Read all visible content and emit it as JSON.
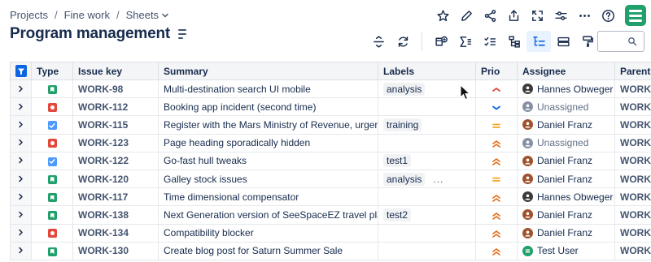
{
  "breadcrumb": {
    "items": [
      "Projects",
      "Fine work",
      "Sheets"
    ],
    "separator": "/"
  },
  "page": {
    "title": "Program management"
  },
  "top_actions": [
    "star-icon",
    "edit-icon",
    "share-icon",
    "export-icon",
    "fullscreen-icon",
    "settings-sliders-icon",
    "more-icon",
    "help-icon",
    "app-logo"
  ],
  "toolbar": {
    "tools": [
      "row-height-icon",
      "refresh-icon",
      "add-field-icon",
      "sum-icon",
      "checklist-icon",
      "hierarchy-icon",
      "hierarchy-structure-icon",
      "card-view-icon",
      "paint-format-icon"
    ],
    "active_tool": "hierarchy-structure-icon",
    "search_placeholder": ""
  },
  "table": {
    "columns": [
      "Type",
      "Issue key",
      "Summary",
      "Labels",
      "Prio",
      "Assignee",
      "Parent"
    ],
    "rows": [
      {
        "type": "story",
        "key": "WORK-98",
        "summary": "Multi-destination search UI mobile",
        "labels": [
          "analysis"
        ],
        "more": "",
        "priority": "high",
        "assignee": "Hannes Obweger",
        "avatar": "hannes",
        "parent": "WORK"
      },
      {
        "type": "bug",
        "key": "WORK-112",
        "summary": "Booking app incident (second time)",
        "labels": [],
        "more": "",
        "priority": "low",
        "assignee": "Unassigned",
        "avatar": "none",
        "parent": "WORK"
      },
      {
        "type": "task",
        "key": "WORK-115",
        "summary": "Register with the Mars Ministry of Revenue, urgently",
        "labels": [
          "training"
        ],
        "more": "",
        "priority": "medium",
        "assignee": "Daniel Franz",
        "avatar": "daniel",
        "parent": "WORK"
      },
      {
        "type": "bug",
        "key": "WORK-123",
        "summary": "Page heading sporadically hidden",
        "labels": [],
        "more": "",
        "priority": "highest",
        "assignee": "Unassigned",
        "avatar": "none",
        "parent": "WORK"
      },
      {
        "type": "task",
        "key": "WORK-122",
        "summary": "Go-fast hull tweaks",
        "labels": [
          "test1"
        ],
        "more": "",
        "priority": "highest",
        "assignee": "Daniel Franz",
        "avatar": "daniel",
        "parent": "WORK"
      },
      {
        "type": "story",
        "key": "WORK-120",
        "summary": "Galley stock issues",
        "labels": [
          "analysis"
        ],
        "more": "...",
        "priority": "medium",
        "assignee": "Daniel Franz",
        "avatar": "daniel",
        "parent": "WORK"
      },
      {
        "type": "story",
        "key": "WORK-117",
        "summary": "Time dimensional compensator",
        "labels": [],
        "more": "",
        "priority": "highest",
        "assignee": "Hannes Obweger",
        "avatar": "hannes",
        "parent": "WORK"
      },
      {
        "type": "story",
        "key": "WORK-138",
        "summary": "Next Generation version of SeeSpaceEZ travel platf…",
        "labels": [
          "test2"
        ],
        "more": "",
        "priority": "highest",
        "assignee": "Daniel Franz",
        "avatar": "daniel",
        "parent": "WORK"
      },
      {
        "type": "bug",
        "key": "WORK-134",
        "summary": "Compatibility blocker",
        "labels": [],
        "more": "",
        "priority": "highest",
        "assignee": "Daniel Franz",
        "avatar": "daniel",
        "parent": "WORK"
      },
      {
        "type": "story",
        "key": "WORK-130",
        "summary": "Create blog post for Saturn Summer Sale",
        "labels": [],
        "more": "",
        "priority": "highest",
        "assignee": "Test User",
        "avatar": "test",
        "parent": "WORK"
      }
    ]
  },
  "colors": {
    "accent": "#0c66e4",
    "story": "#22a06b",
    "bug": "#e2483d",
    "task": "#4c9aff",
    "priority_high": "#e2483d",
    "priority_low": "#0c66e4",
    "priority_medium": "#f5a623",
    "priority_highest": "#e56910"
  }
}
